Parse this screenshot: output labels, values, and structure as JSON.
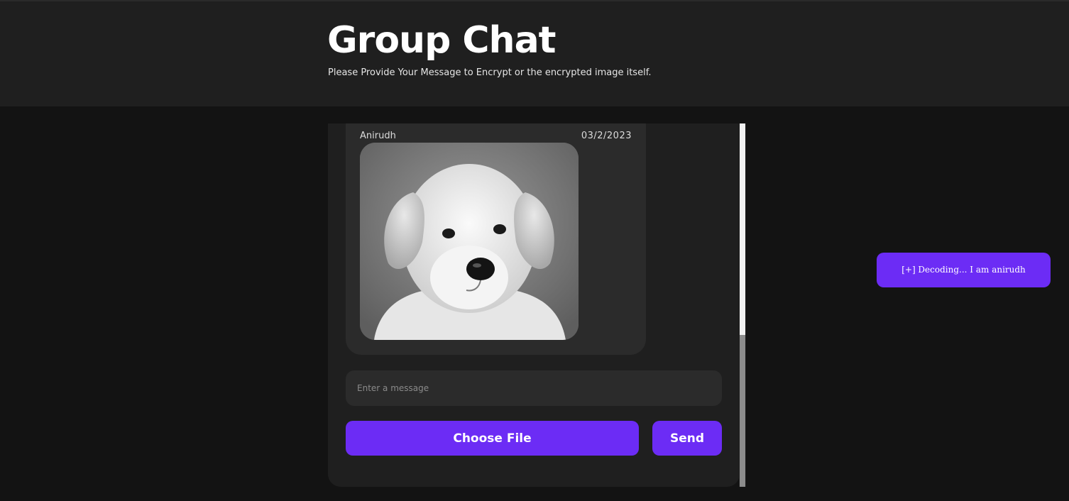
{
  "header": {
    "title": "Group Chat",
    "subtitle": "Please Provide Your Message to Encrypt or the encrypted image itself."
  },
  "chat": {
    "message": {
      "sender": "Anirudh",
      "date": "03/2/2023",
      "image_icon": "puppy-photo"
    },
    "input": {
      "placeholder": "Enter a message",
      "value": ""
    },
    "choose_file_label": "Choose File",
    "send_label": "Send"
  },
  "status": {
    "decode_text": "[+] Decoding... I am anirudh"
  },
  "colors": {
    "background": "#131313",
    "header_bg": "#1f1f1f",
    "panel_bg": "#1f1f1f",
    "card_bg": "#2b2b2b",
    "accent": "#6c2cf5",
    "text": "#ffffff"
  }
}
